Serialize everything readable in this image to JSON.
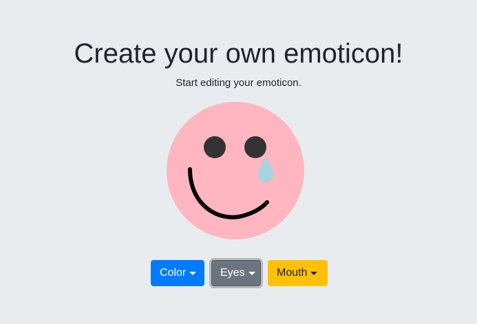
{
  "header": {
    "title": "Create your own emoticon!",
    "subtitle": "Start editing your emoticon."
  },
  "emoticon": {
    "face_color": "#ffb6c1",
    "eye_color": "#333333",
    "tear_color": "#a6d4df",
    "mouth_color": "#000000",
    "features": [
      "face",
      "left-eye",
      "right-eye",
      "tear",
      "smile-mouth"
    ]
  },
  "controls": {
    "color_label": "Color",
    "eyes_label": "Eyes",
    "mouth_label": "Mouth",
    "colors": {
      "color_button": "#007bff",
      "eyes_button": "#6c757d",
      "mouth_button": "#ffc107"
    },
    "focused": "eyes"
  }
}
